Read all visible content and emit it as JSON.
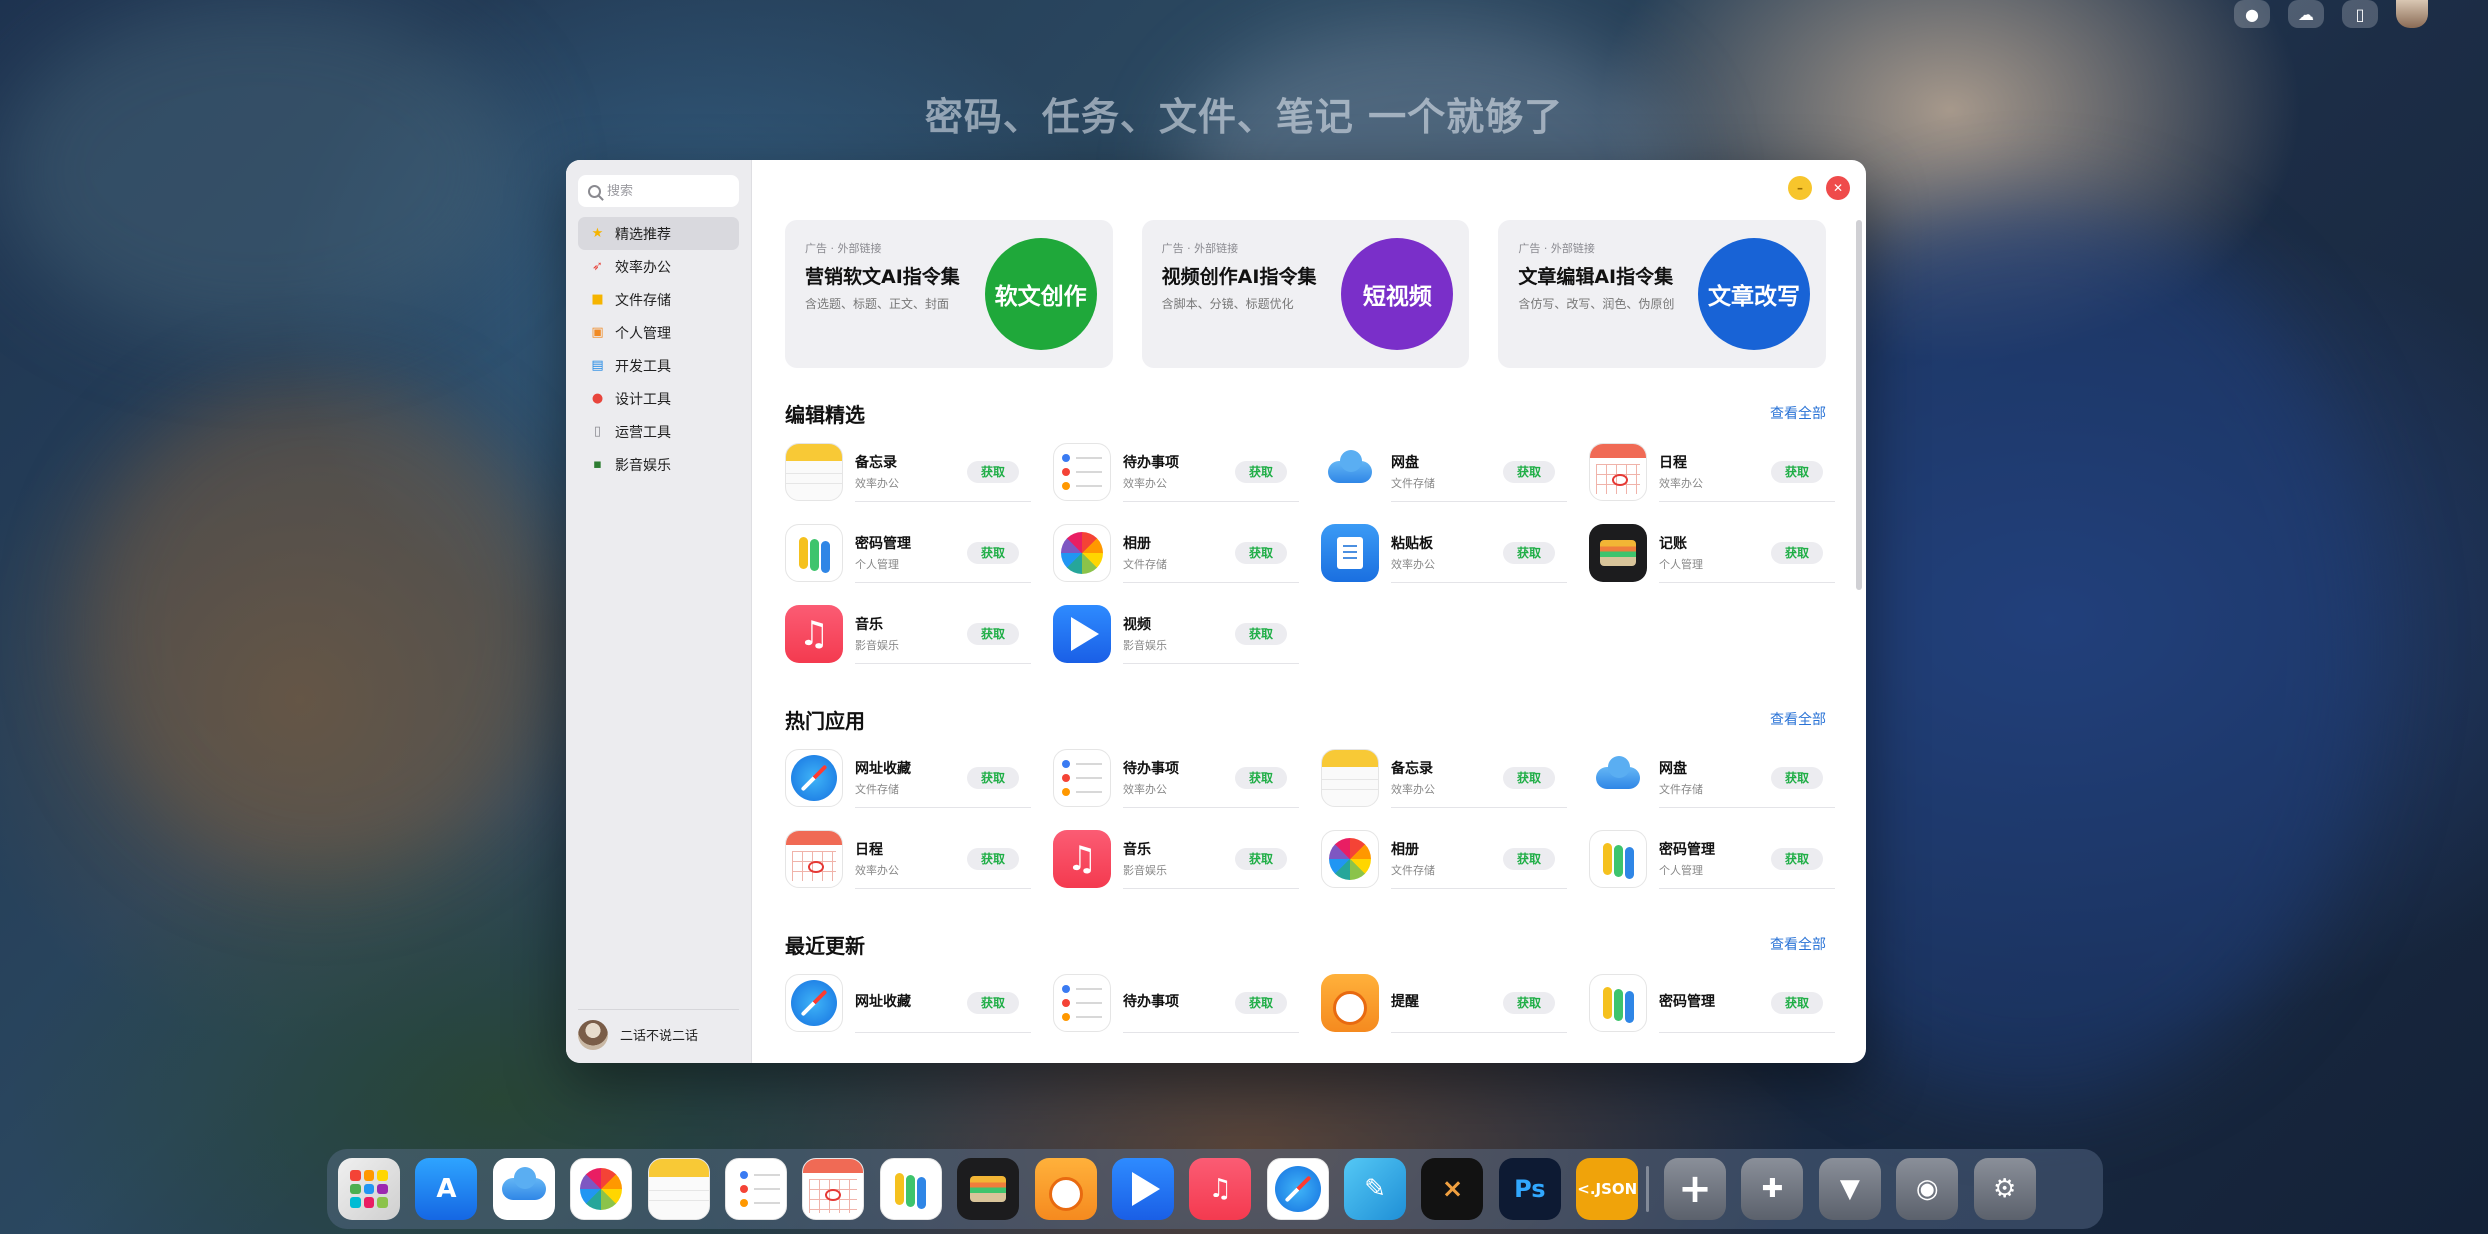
{
  "desktop": {
    "headline": "密码、任务、文件、笔记 一个就够了"
  },
  "search": {
    "placeholder": "搜索"
  },
  "sidebar": {
    "items": [
      {
        "label": "精选推荐",
        "icon": "star-icon",
        "color": "#f5b400",
        "active": true
      },
      {
        "label": "效率办公",
        "icon": "rocket-icon",
        "color": "#e8453c"
      },
      {
        "label": "文件存储",
        "icon": "folder-icon",
        "color": "#f5b400"
      },
      {
        "label": "个人管理",
        "icon": "lock-icon",
        "color": "#f08a24"
      },
      {
        "label": "开发工具",
        "icon": "terminal-icon",
        "color": "#1e88e5"
      },
      {
        "label": "设计工具",
        "icon": "palette-icon",
        "color": "#e8453c"
      },
      {
        "label": "运营工具",
        "icon": "document-icon",
        "color": "#8a8a90"
      },
      {
        "label": "影音娱乐",
        "icon": "film-icon",
        "color": "#2e7d32"
      }
    ],
    "user": {
      "name": "二话不说二话"
    }
  },
  "ads": [
    {
      "tag": "广告 · 外部链接",
      "title": "营销软文AI指令集",
      "desc": "含选题、标题、正文、封面",
      "badge": "软文创作",
      "color": "#1fa83a"
    },
    {
      "tag": "广告 · 外部链接",
      "title": "视频创作AI指令集",
      "desc": "含脚本、分镜、标题优化",
      "badge": "短视频",
      "color": "#7a2fc9"
    },
    {
      "tag": "广告 · 外部链接",
      "title": "文章编辑AI指令集",
      "desc": "含仿写、改写、润色、伪原创",
      "badge": "文章改写",
      "color": "#1863d6"
    }
  ],
  "get_label": "获取",
  "see_all_label": "查看全部",
  "sections": [
    {
      "title": "编辑精选",
      "apps": [
        {
          "name": "备忘录",
          "category": "效率办公",
          "icon": "notes-icon"
        },
        {
          "name": "待办事项",
          "category": "效率办公",
          "icon": "todo-icon"
        },
        {
          "name": "网盘",
          "category": "文件存储",
          "icon": "cloud-drive-icon"
        },
        {
          "name": "日程",
          "category": "效率办公",
          "icon": "calendar-icon"
        },
        {
          "name": "密码管理",
          "category": "个人管理",
          "icon": "password-keys-icon"
        },
        {
          "name": "相册",
          "category": "文件存储",
          "icon": "photos-icon"
        },
        {
          "name": "粘贴板",
          "category": "效率办公",
          "icon": "clipboard-icon"
        },
        {
          "name": "记账",
          "category": "个人管理",
          "icon": "wallet-icon"
        },
        {
          "name": "音乐",
          "category": "影音娱乐",
          "icon": "music-icon"
        },
        {
          "name": "视频",
          "category": "影音娱乐",
          "icon": "video-play-icon"
        }
      ]
    },
    {
      "title": "热门应用",
      "apps": [
        {
          "name": "网址收藏",
          "category": "文件存储",
          "icon": "safari-compass-icon"
        },
        {
          "name": "待办事项",
          "category": "效率办公",
          "icon": "todo-icon"
        },
        {
          "name": "备忘录",
          "category": "效率办公",
          "icon": "notes-icon"
        },
        {
          "name": "网盘",
          "category": "文件存储",
          "icon": "cloud-drive-icon"
        },
        {
          "name": "日程",
          "category": "效率办公",
          "icon": "calendar-icon"
        },
        {
          "name": "音乐",
          "category": "影音娱乐",
          "icon": "music-icon"
        },
        {
          "name": "相册",
          "category": "文件存储",
          "icon": "photos-icon"
        },
        {
          "name": "密码管理",
          "category": "个人管理",
          "icon": "password-keys-icon"
        }
      ]
    },
    {
      "title": "最近更新",
      "apps": [
        {
          "name": "网址收藏",
          "category": "",
          "icon": "safari-compass-icon"
        },
        {
          "name": "待办事项",
          "category": "",
          "icon": "todo-icon"
        },
        {
          "name": "提醒",
          "category": "",
          "icon": "alarm-clock-icon"
        },
        {
          "name": "密码管理",
          "category": "",
          "icon": "password-keys-icon"
        }
      ]
    }
  ],
  "dock": [
    {
      "icon": "launchpad-icon"
    },
    {
      "icon": "app-store-icon"
    },
    {
      "icon": "cloud-drive-icon"
    },
    {
      "icon": "photos-icon"
    },
    {
      "icon": "notes-icon"
    },
    {
      "icon": "todo-icon"
    },
    {
      "icon": "calendar-icon"
    },
    {
      "icon": "password-keys-icon"
    },
    {
      "icon": "wallet-icon"
    },
    {
      "icon": "alarm-clock-icon"
    },
    {
      "icon": "video-play-icon"
    },
    {
      "icon": "music-icon"
    },
    {
      "icon": "safari-compass-icon"
    },
    {
      "icon": "pen-notes-icon"
    },
    {
      "icon": "diff-merge-icon"
    },
    {
      "icon": "photoshop-icon",
      "text": "Ps"
    },
    {
      "icon": "json-icon",
      "text": "<.JSON"
    },
    {
      "icon": "plus-icon"
    },
    {
      "icon": "puzzle-icon"
    },
    {
      "icon": "paint-brush-icon"
    },
    {
      "icon": "lock-settings-icon"
    },
    {
      "icon": "system-settings-icon"
    }
  ]
}
